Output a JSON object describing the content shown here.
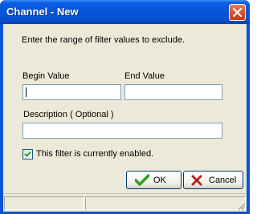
{
  "window": {
    "title": "Channel - New"
  },
  "titlebar": {
    "close_icon": "close-icon"
  },
  "form": {
    "prompt": "Enter the range of filter values to exclude.",
    "begin_label": "Begin Value",
    "begin_value": "",
    "end_label": "End Value",
    "end_value": "",
    "description_label": "Description ( Optional )",
    "description_value": "",
    "enabled_label": "This filter is currently enabled.",
    "enabled_checked": true
  },
  "buttons": {
    "ok_label": "OK",
    "ok_icon": "checkmark-icon",
    "cancel_label": "Cancel",
    "cancel_icon": "x-icon"
  },
  "colors": {
    "titlebar": "#0a52d6",
    "face": "#ece9d8",
    "ok_icon": "#2f9e1e",
    "cancel_icon": "#b3261e"
  }
}
